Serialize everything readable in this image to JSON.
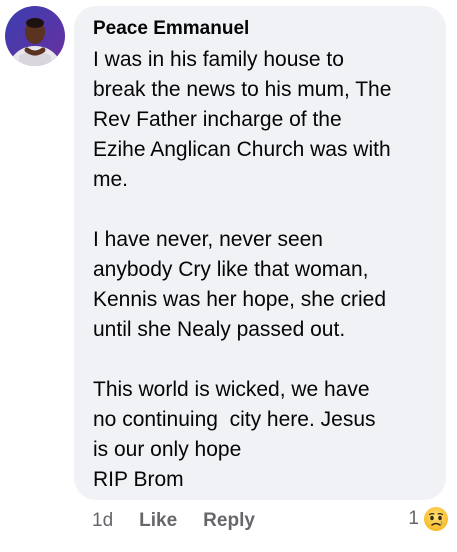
{
  "comment": {
    "author": "Peace Emmanuel",
    "paragraphs": [
      "I was in his family house to\nbreak the news to his mum, The\nRev Father incharge of the\nEzihe Anglican Church was with\nme.",
      "I have never, never seen\nanybody Cry like that woman,\nKennis was her hope, she cried\nuntil she Nealy passed out.",
      "This world is wicked, we have\nno continuing  city here. Jesus\nis our only hope\nRIP Brom"
    ],
    "avatar_icon": "profile-photo"
  },
  "actions": {
    "time": "1d",
    "like_label": "Like",
    "reply_label": "Reply"
  },
  "reaction": {
    "count": "1",
    "icon": "sad-face-icon"
  },
  "colors": {
    "bubble": "#f0f2f5",
    "text": "#050505",
    "meta": "#65676b"
  }
}
